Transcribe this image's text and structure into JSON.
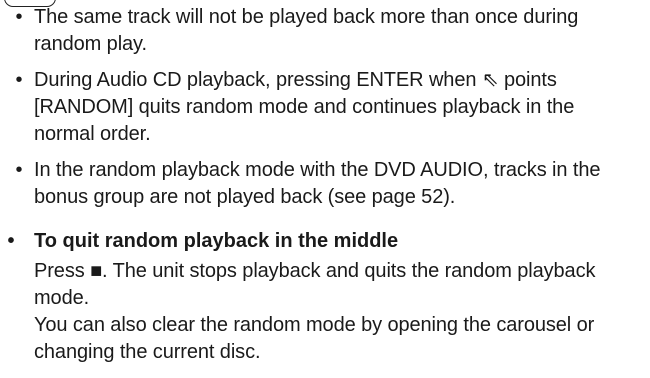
{
  "notes": {
    "items": [
      {
        "bullet": "•",
        "text": "The same track will not be played back more than once during random play."
      },
      {
        "bullet": "•",
        "text": "During Audio CD playback, pressing ENTER when ⇖ points [RANDOM] quits random mode and continues playback in the normal order."
      },
      {
        "bullet": "•",
        "text": "In the random playback mode with the DVD AUDIO, tracks in the bonus group are not played back (see page 52)."
      }
    ]
  },
  "quit_section": {
    "bullet": "•",
    "heading": "To quit random playback in the middle",
    "paragraph_1": "Press ■. The unit stops playback and quits the random playback mode.",
    "paragraph_2": "You can also clear the random mode by opening the carousel or changing the current disc."
  }
}
